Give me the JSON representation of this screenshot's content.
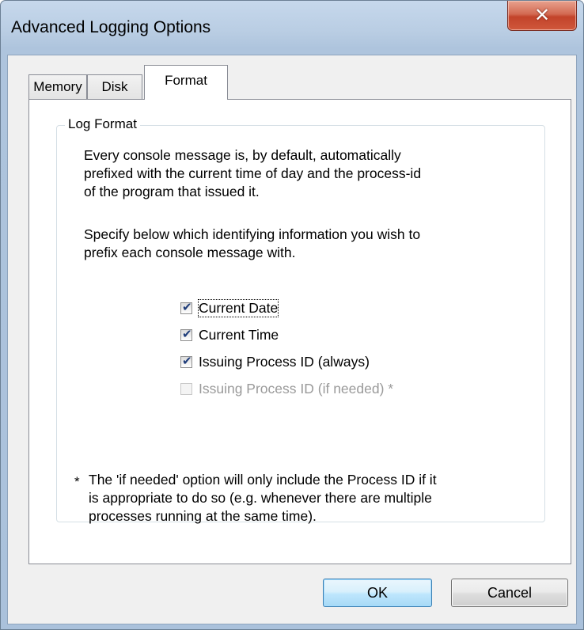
{
  "window": {
    "title": "Advanced Logging Options",
    "close_glyph": "✕"
  },
  "tabs": [
    {
      "label": "Memory",
      "active": false
    },
    {
      "label": "Disk",
      "active": false
    },
    {
      "label": "Format",
      "active": true
    }
  ],
  "group": {
    "title": "Log Format",
    "paragraph1": "Every console message is, by default, automatically\nprefixed with the current time of day and the process-id\nof the program that issued it.",
    "paragraph2": "Specify below which identifying information you wish to\nprefix each console message with."
  },
  "options": [
    {
      "label": "Current Date",
      "checked": true,
      "enabled": true
    },
    {
      "label": "Current Time",
      "checked": true,
      "enabled": true
    },
    {
      "label": "Issuing Process ID (always)",
      "checked": true,
      "enabled": true
    },
    {
      "label": "Issuing Process ID (if needed) *",
      "checked": false,
      "enabled": false
    }
  ],
  "footnote": {
    "mark": "*",
    "text": "The 'if needed' option will only include the Process ID if it\nis appropriate to do so (e.g. whenever there are multiple\nprocesses running at the same time)."
  },
  "buttons": {
    "ok": "OK",
    "cancel": "Cancel"
  },
  "checkmark": "✔",
  "colors": {
    "title_bar": "#b9cde3",
    "close_button": "#c2432a",
    "ok_button": "#bee6fd"
  }
}
